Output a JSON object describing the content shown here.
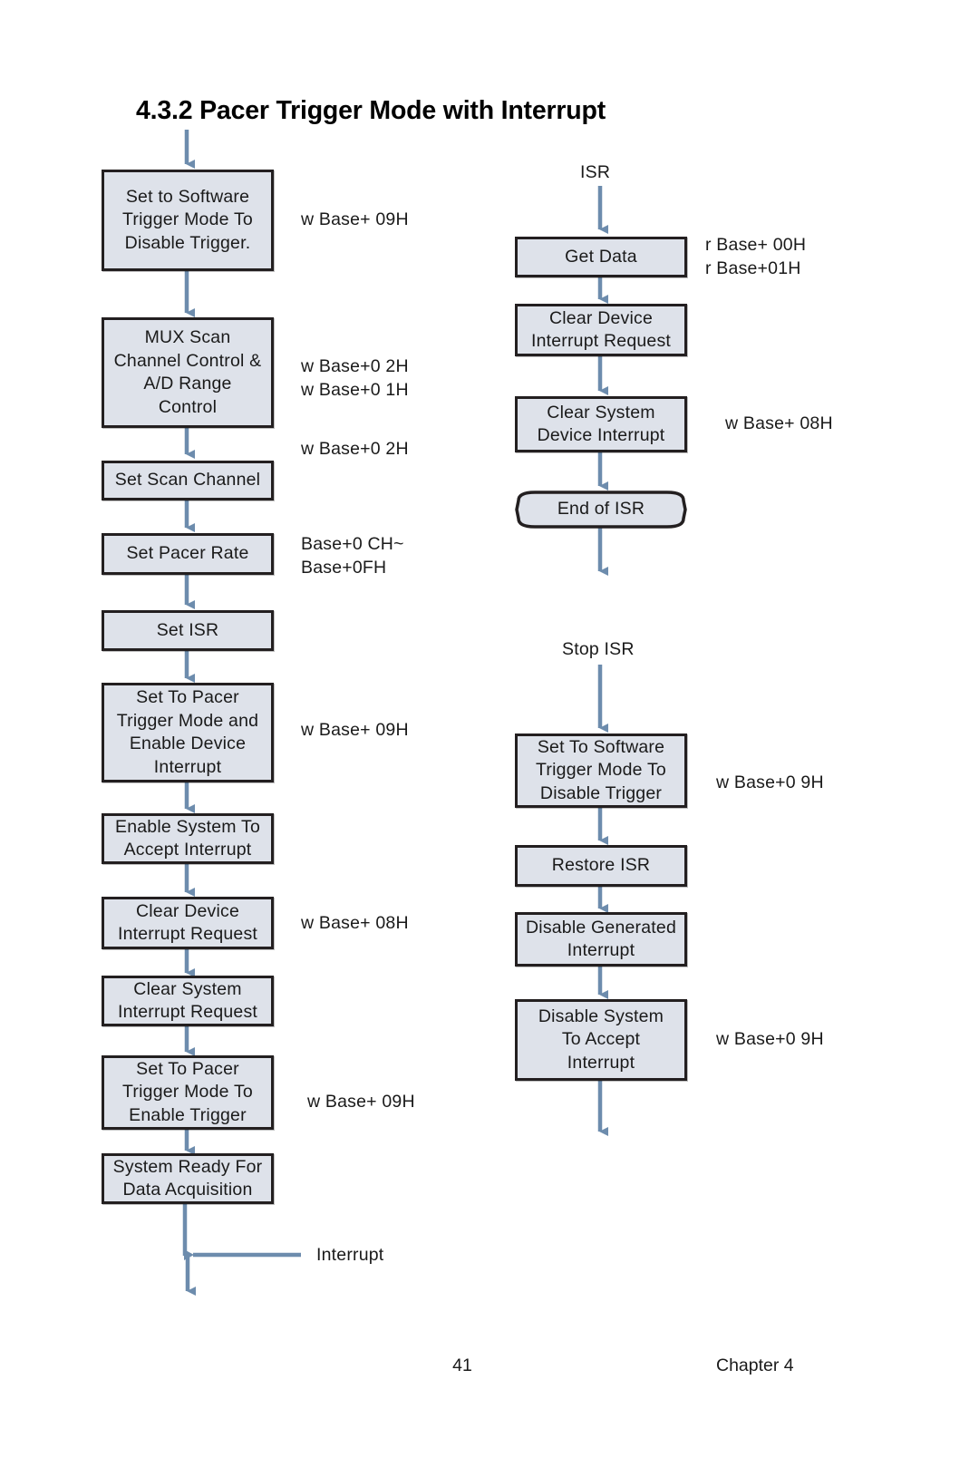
{
  "document": {
    "heading": "4.3.2 Pacer Trigger Mode with Interrupt",
    "footer": {
      "page_number": "41",
      "chapter": "Chapter 4"
    }
  },
  "colors": {
    "node_fill": "#dee2ea",
    "node_border": "#231f20",
    "connector": "#6d8cad",
    "text": "#1a1a1a",
    "page_background": "#ffffff"
  },
  "chart_data": {
    "type": "diagram",
    "title": "4.3.2 Pacer Trigger Mode with Interrupt",
    "subtype": "flowchart",
    "columns": [
      {
        "id": "main-flow",
        "name": "Main Program Flow",
        "entry_label": "",
        "nodes": [
          "Set to Software Trigger Mode To Disable Trigger.",
          "MUX Scan Channel Control & A/D Range Control",
          "Set Scan Channel",
          "Set Pacer Rate",
          "Set ISR",
          "Set To Pacer Trigger Mode and Enable Device Interrupt",
          "Enable System To Accept Interrupt",
          "Clear Device Interrupt Request",
          "Clear System Interrupt Request",
          "Set To Pacer Trigger Mode To Enable Trigger",
          "System Ready For Data Acquisition"
        ],
        "annotations": [
          "w Base+ 09H",
          "w Base+0 2H\nw Base+0 1H",
          "w Base+0 2H",
          "Base+0 CH~\nBase+0FH",
          "w Base+ 09H",
          "w Base+ 08H",
          "w Base+ 09H"
        ]
      },
      {
        "id": "isr-flow",
        "name": "Interrupt Service Routine",
        "entry_label": "ISR",
        "nodes": [
          "Get Data",
          "Clear Device Interrupt Request",
          "Clear System Device Interrupt",
          "End of ISR"
        ],
        "annotations": [
          "r Base+ 00H\nr Base+01H",
          "w Base+ 08H"
        ]
      },
      {
        "id": "stop-isr-flow",
        "name": "Stop ISR Flow",
        "entry_label": "Stop  ISR",
        "nodes": [
          "Set To Software Trigger Mode To Disable Trigger",
          "Restore ISR",
          "Disable Generated Interrupt",
          "Disable System To Accept Interrupt"
        ],
        "annotations": [
          "w Base+0 9H",
          "w Base+0 9H"
        ]
      }
    ],
    "external_events": [
      {
        "label": "Interrupt",
        "target": "main-flow-exit"
      }
    ]
  },
  "nodes": {
    "left": {
      "n1": "Set  to  Software\nTrigger  Mode  To\nDisable  Trigger.",
      "n2": "MUX  Scan\nChannel  Control  &\nA/D  Range\nControl",
      "n3": "Set  Scan  Channel",
      "n4": "Set  Pacer  Rate",
      "n5": "Set  ISR",
      "n6": "Set  To  Pacer\nTrigger  Mode  and\nEnable  Device\nInterrupt",
      "n7": "Enable  System  To\nAccept  Interrupt",
      "n8": "Clear  Device\nInterrupt  Request",
      "n9": "Clear  System\nInterrupt  Request",
      "n10": "Set  To  Pacer\nTrigger  Mode  To\nEnable  Trigger",
      "n11": "System  Ready  For\nData  Acquisition"
    },
    "right_isr": {
      "r1": "Get  Data",
      "r2": "Clear  Device\nInterrupt  Request",
      "r3": "Clear  System\nDevice  Interrupt",
      "r4": "End  of  ISR"
    },
    "right_stop": {
      "s1": "Set  To  Software\nTrigger  Mode  To\nDisable  Trigger",
      "s2": "Restore  ISR",
      "s3": "Disable  Generated\nInterrupt",
      "s4": "Disable  System\nTo  Accept\nInterrupt"
    }
  },
  "annotations": {
    "left": {
      "a1": "w Base+ 09H",
      "a2": "w Base+0 2H\nw Base+0 1H",
      "a3": "w Base+0 2H",
      "a4": "Base+0 CH~\nBase+0FH",
      "a5": "w Base+ 09H",
      "a6": "w Base+ 08H",
      "a7": "w Base+ 09H"
    },
    "right": {
      "b1": "r Base+ 00H\nr Base+01H",
      "b2": "w Base+ 08H",
      "b3": "w Base+0 9H",
      "b4": "w Base+0 9H"
    }
  },
  "labels": {
    "isr_entry": "ISR",
    "stop_isr_entry": "Stop  ISR",
    "interrupt_event": "Interrupt"
  }
}
